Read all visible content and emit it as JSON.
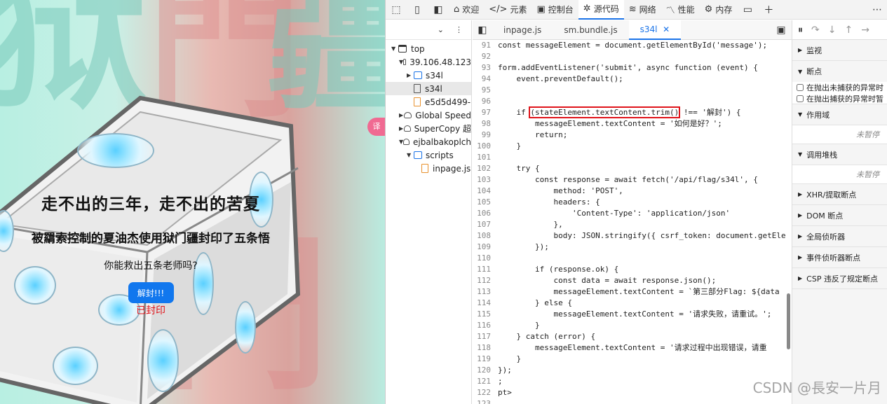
{
  "page": {
    "hero_title": "走不出的三年，走不出的苦夏",
    "hero_sub": "被羂索控制的夏油杰使用狱门疆封印了五条悟",
    "hero_question": "你能救出五条老师吗?",
    "unseal_button": "解封!!!",
    "status_text": "已封印",
    "translate_chip": "译",
    "background_colors": {
      "mint": "#b8efe2",
      "pink": "#e8b9b2"
    }
  },
  "devtools": {
    "tabs": [
      {
        "icon": "home-icon",
        "glyph": "⌂",
        "label": "欢迎"
      },
      {
        "icon": "elements-icon",
        "glyph": "</>",
        "label": "元素"
      },
      {
        "icon": "console-icon",
        "glyph": "▣",
        "label": "控制台"
      },
      {
        "icon": "sources-icon",
        "glyph": "✲",
        "label": "源代码"
      },
      {
        "icon": "network-icon",
        "glyph": "≋",
        "label": "网络"
      },
      {
        "icon": "performance-icon",
        "glyph": "〽",
        "label": "性能"
      },
      {
        "icon": "memory-icon",
        "glyph": "⚙",
        "label": "内存"
      }
    ],
    "tree": [
      {
        "label": "top",
        "indent": 0,
        "arrow": "▼",
        "kind": "frame"
      },
      {
        "label": "39.106.48.123",
        "indent": 1,
        "arrow": "▼",
        "kind": "cloud"
      },
      {
        "label": "s34l",
        "indent": 2,
        "arrow": "▶",
        "kind": "folder"
      },
      {
        "label": "s34l",
        "indent": 2,
        "arrow": "",
        "kind": "file",
        "selected": true
      },
      {
        "label": "e5d5d499-",
        "indent": 2,
        "arrow": "",
        "kind": "file-orange"
      },
      {
        "label": "Global Speed",
        "indent": 1,
        "arrow": "▶",
        "kind": "cloud"
      },
      {
        "label": "SuperCopy 超",
        "indent": 1,
        "arrow": "▶",
        "kind": "cloud"
      },
      {
        "label": "ejbalbakoplch",
        "indent": 1,
        "arrow": "▼",
        "kind": "cloud"
      },
      {
        "label": "scripts",
        "indent": 2,
        "arrow": "▼",
        "kind": "folder"
      },
      {
        "label": "inpage.js",
        "indent": 3,
        "arrow": "",
        "kind": "file-orange"
      }
    ],
    "editor_tabs": [
      "inpage.js",
      "sm.bundle.js",
      "s34l"
    ],
    "code": [
      {
        "n": "91",
        "t": "const messageElement = document.getElementById('message');"
      },
      {
        "n": "92",
        "t": ""
      },
      {
        "n": "93",
        "t": "form.addEventListener('submit', async function (event) {"
      },
      {
        "n": "94",
        "t": "    event.preventDefault();"
      },
      {
        "n": "95",
        "t": ""
      },
      {
        "n": "96",
        "t": ""
      },
      {
        "n": "97",
        "t": "    if (stateElement.textContent.trim() !== '解封') {"
      },
      {
        "n": "98",
        "t": "        messageElement.textContent = '如何是好？';"
      },
      {
        "n": "99",
        "t": "        return;"
      },
      {
        "n": "100",
        "t": "    }"
      },
      {
        "n": "101",
        "t": ""
      },
      {
        "n": "102",
        "t": "    try {"
      },
      {
        "n": "103",
        "t": "        const response = await fetch('/api/flag/s34l', {"
      },
      {
        "n": "104",
        "t": "            method: 'POST',"
      },
      {
        "n": "105",
        "t": "            headers: {"
      },
      {
        "n": "106",
        "t": "                'Content-Type': 'application/json'"
      },
      {
        "n": "107",
        "t": "            },"
      },
      {
        "n": "108",
        "t": "            body: JSON.stringify({ csrf_token: document.getEle"
      },
      {
        "n": "109",
        "t": "        });"
      },
      {
        "n": "110",
        "t": ""
      },
      {
        "n": "111",
        "t": "        if (response.ok) {"
      },
      {
        "n": "112",
        "t": "            const data = await response.json();"
      },
      {
        "n": "113",
        "t": "            messageElement.textContent = `第三部分Flag: ${data"
      },
      {
        "n": "114",
        "t": "        } else {"
      },
      {
        "n": "115",
        "t": "            messageElement.textContent = '请求失败，请重试。';"
      },
      {
        "n": "116",
        "t": "        }"
      },
      {
        "n": "117",
        "t": "    } catch (error) {"
      },
      {
        "n": "118",
        "t": "        messageElement.textContent = '请求过程中出现错误，请重"
      },
      {
        "n": "119",
        "t": "    }"
      },
      {
        "n": "120",
        "t": "});"
      },
      {
        "n": "121",
        "t": ";"
      },
      {
        "n": "122",
        "t": "pt>"
      },
      {
        "n": "123",
        "t": ""
      }
    ],
    "right_panel": {
      "watch": "监视",
      "breakpoints": "断点",
      "pause_uncaught": "在抛出未捕获的异常时",
      "pause_caught": "在抛出捕获的异常时暂",
      "scope": "作用域",
      "scope_note": "未暂停",
      "callstack": "调用堆栈",
      "callstack_note": "未暂停",
      "xhr": "XHR/提取断点",
      "dom": "DOM 断点",
      "global": "全局侦听器",
      "event": "事件侦听器断点",
      "csp": "CSP 违反了规定断点"
    }
  },
  "watermark": "CSDN @長安一片月"
}
